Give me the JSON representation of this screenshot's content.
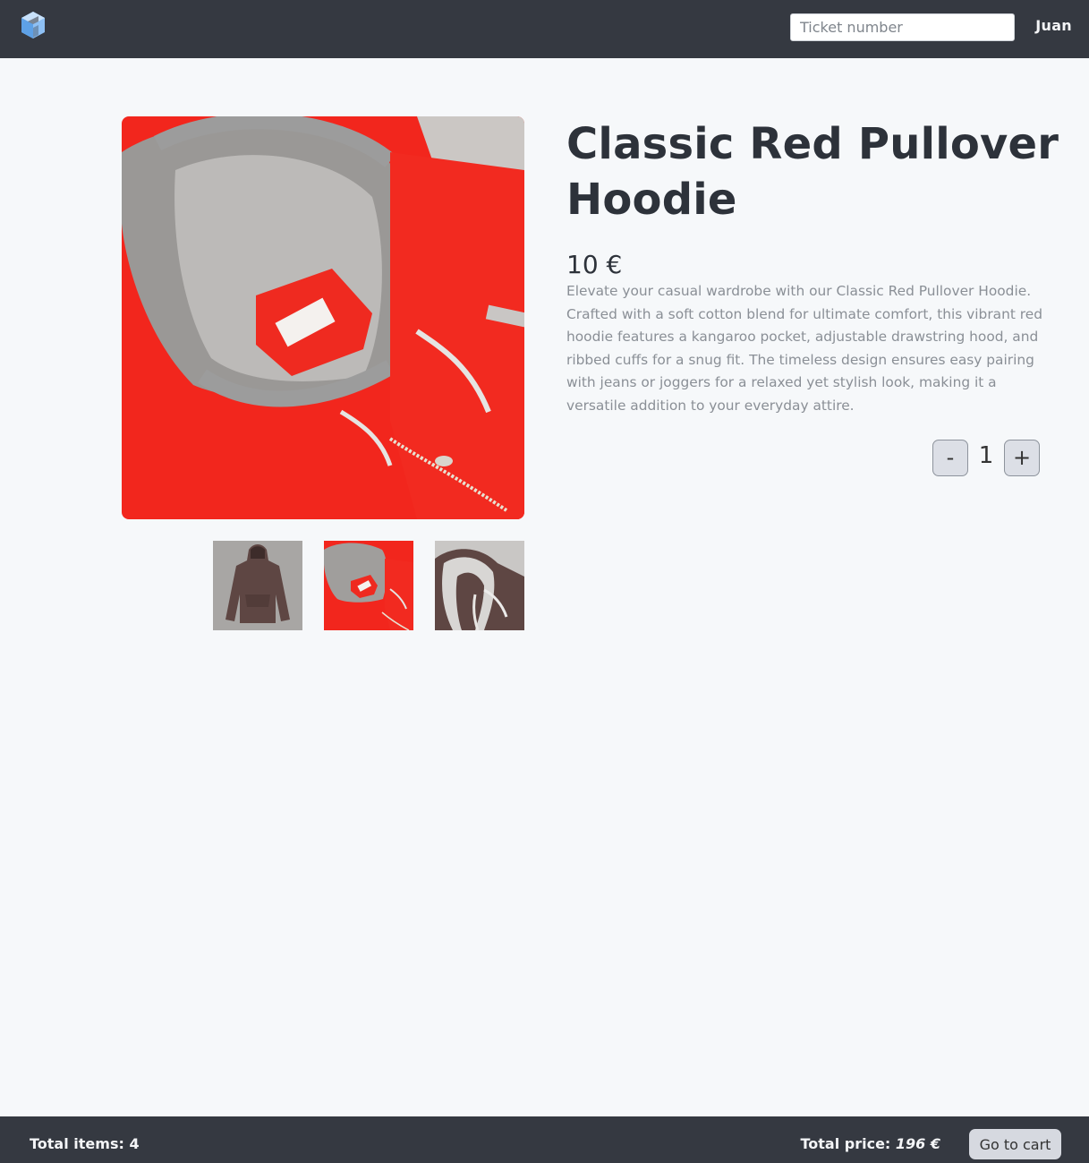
{
  "header": {
    "logo_icon": "cube-logo-icon",
    "ticket_placeholder": "Ticket number",
    "user_name": "Juan"
  },
  "product": {
    "title": "Classic Red Pullover Hoodie",
    "price": "10 €",
    "description": "Elevate your casual wardrobe with our Classic Red Pullover Hoodie. Crafted with a soft cotton blend for ultimate comfort, this vibrant red hoodie features a kangaroo pocket, adjustable drawstring hood, and ribbed cuffs for a snug fit. The timeless design ensures easy pairing with jeans or joggers for a relaxed yet stylish look, making it a versatile addition to your everyday attire.",
    "quantity": "1",
    "minus_label": "-",
    "plus_label": "+",
    "selected_thumbnail": 2
  },
  "footer": {
    "total_items_label": "Total items:",
    "total_items_value": "4",
    "total_price_label": "Total price:",
    "total_price_value": "196 €",
    "go_to_cart_label": "Go to cart"
  },
  "colors": {
    "topbar": "#353941",
    "background": "#f6f8fa",
    "hoodie_red": "#f2261d",
    "hood_lining_gray": "#9c9c9c",
    "brown_hoodie": "#5e4643"
  }
}
